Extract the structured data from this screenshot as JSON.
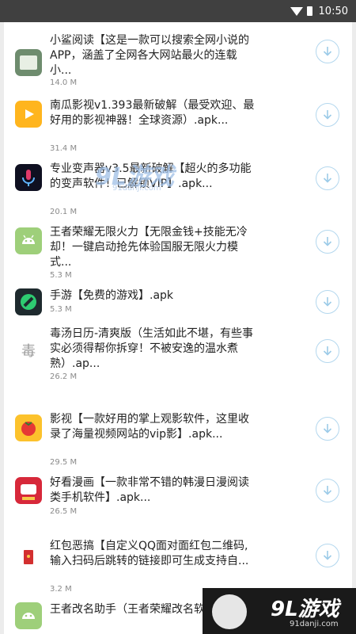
{
  "status_bar": {
    "time": "10:50",
    "wifi_icon": "wifi-icon",
    "battery_icon": "battery-icon"
  },
  "apps": [
    {
      "title": "小鲨阅读【这是一款可以搜索全网小说的APP，涵盖了全网各大网站最火的连载小...",
      "size": "14.0 M",
      "icon": "book-icon"
    },
    {
      "title": "南瓜影视v1.393最新破解（最受欢迎、最好用的影视神器！全球资源）.apk...",
      "size": "31.4 M",
      "icon": "pumpkin-video-icon"
    },
    {
      "title": "专业变声器v3.5最新破解【超火的多功能的变声软件！已解锁VIP】.apk...",
      "size": "20.1 M",
      "icon": "voice-changer-icon"
    },
    {
      "title": "王者荣耀无限火力【无限金钱+技能无冷却！一键启动抢先体验国服无限火力模式...",
      "size": "5.3 M",
      "icon": "android-icon"
    },
    {
      "title": "手游【免费的游戏】.apk",
      "size": "5.3 M",
      "icon": "game-g-icon"
    },
    {
      "title": "毒汤日历-清爽版（生活如此不堪，有些事实必须得帮你拆穿！不被安逸的温水煮熟）.ap...",
      "size": "26.2 M",
      "icon": "calendar-icon"
    },
    {
      "title": "影视【一款好用的掌上观影软件，这里收录了海量视频网站的vip影】.apk...",
      "size": "29.5 M",
      "icon": "tomato-video-icon"
    },
    {
      "title": "好看漫画【一款非常不错的韩漫日漫阅读类手机软件】.apk...",
      "size": "26.5 M",
      "icon": "comic-icon"
    },
    {
      "title": "红包恶搞【自定义QQ面对面红包二维码,输入扫码后跳转的链接即可生成支持自...",
      "size": "3.2 M",
      "icon": "red-packet-icon"
    },
    {
      "title": "王者改名助手（王者荣耀改名软件）.apk",
      "size": "",
      "icon": "android-icon"
    }
  ],
  "watermark": {
    "brand": "9L游戏",
    "url": "91danji.com"
  },
  "colors": {
    "accent": "#b3d7ee",
    "status_bar": "#404040"
  }
}
